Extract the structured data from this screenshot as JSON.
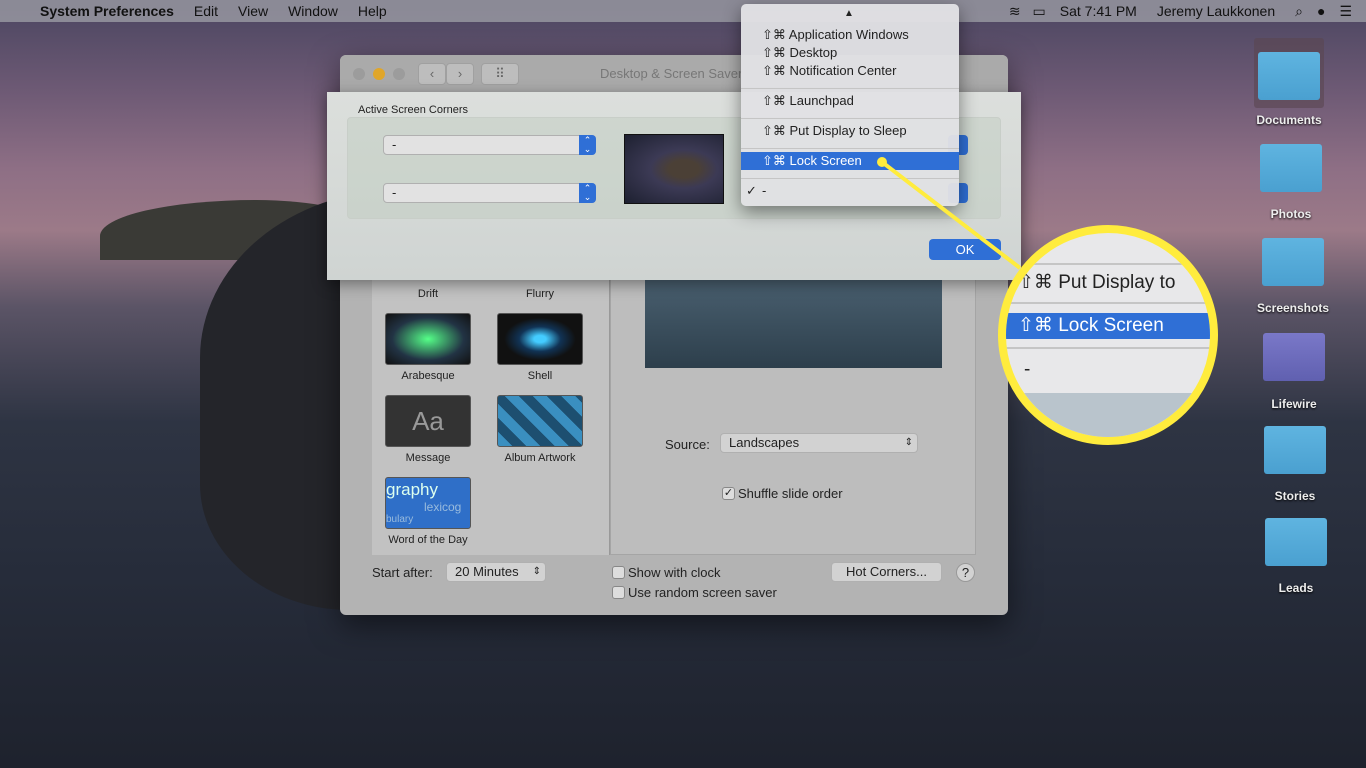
{
  "menubar": {
    "app": "System Preferences",
    "items": [
      "Edit",
      "View",
      "Window",
      "Help"
    ],
    "clock": "Sat 7:41 PM",
    "user": "Jeremy Laukkonen"
  },
  "window": {
    "title": "Desktop & Screen Saver"
  },
  "sheet": {
    "title": "Active Screen Corners",
    "top_left": "-",
    "bottom_left": "-",
    "ok": "OK"
  },
  "corner_menu": {
    "items": [
      "⇧⌘ Application Windows",
      "⇧⌘ Desktop",
      "⇧⌘ Notification Center",
      "⇧⌘ Launchpad",
      "⇧⌘ Put Display to Sleep",
      "⇧⌘ Lock Screen",
      "-"
    ],
    "selected": "⇧⌘ Lock Screen",
    "checked": "-",
    "check_mark": "✓"
  },
  "magnifier": {
    "items": [
      "⇧⌘ Put Display to",
      "⇧⌘ Lock Screen",
      "-"
    ]
  },
  "savers": [
    "Drift",
    "Flurry",
    "Arabesque",
    "Shell",
    "Message",
    "Album Artwork",
    "Word of the Day"
  ],
  "message_thumb": "Aa",
  "word_thumb": {
    "big": "graphy",
    "small": "lexicog",
    "tiny": "bulary"
  },
  "source": {
    "label": "Source:",
    "value": "Landscapes"
  },
  "shuffle": {
    "label": "Shuffle slide order",
    "checked": true
  },
  "start_after": {
    "label": "Start after:",
    "value": "20 Minutes"
  },
  "show_clock": {
    "label": "Show with clock",
    "checked": false
  },
  "random": {
    "label": "Use random screen saver",
    "checked": false
  },
  "hot_corners": "Hot Corners...",
  "help": "?",
  "desktop_icons": [
    "Documents",
    "Photos",
    "Screenshots",
    "Lifewire",
    "Stories",
    "Leads"
  ],
  "colors": {
    "accent": "#2f6fd6",
    "highlight": "#ffec3d"
  }
}
